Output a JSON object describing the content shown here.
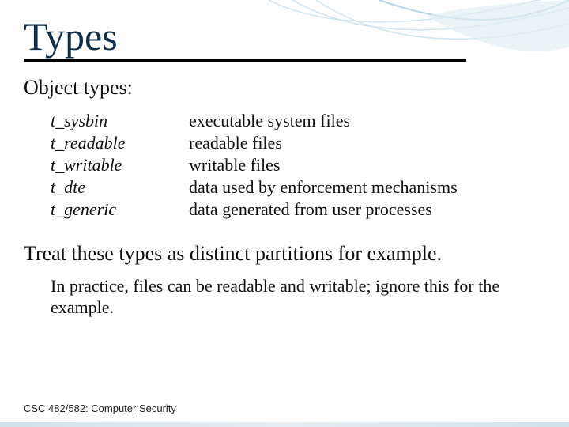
{
  "title": "Types",
  "subtitle": "Object types:",
  "types": [
    {
      "name": "t_sysbin",
      "desc": "executable system files"
    },
    {
      "name": "t_readable",
      "desc": "readable files"
    },
    {
      "name": "t_writable",
      "desc": "writable files"
    },
    {
      "name": "t_dte",
      "desc": "data used by enforcement mechanisms"
    },
    {
      "name": "t_generic",
      "desc": "data generated from user processes"
    }
  ],
  "treat": "Treat these types as distinct partitions for example.",
  "practice": "In practice, files can be readable and writable; ignore this for the example.",
  "footer": "CSC 482/582: Computer Security"
}
